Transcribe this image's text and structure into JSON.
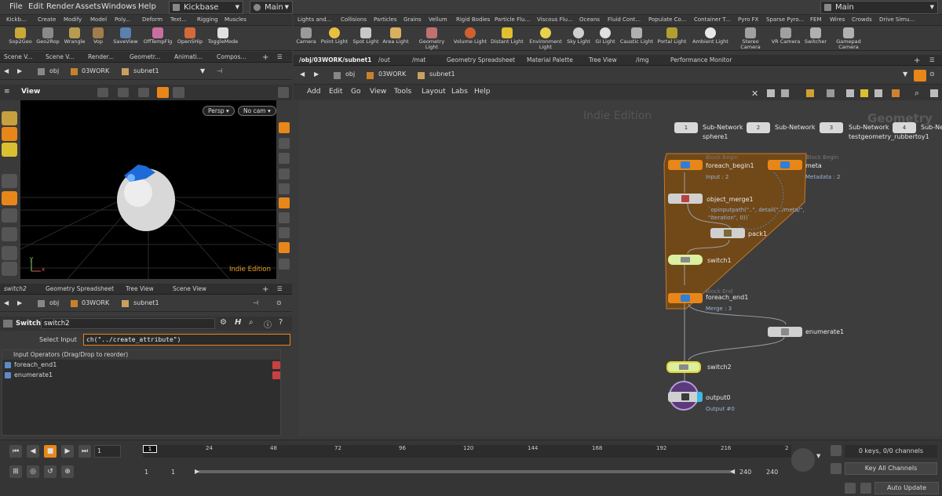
{
  "menu": {
    "file": "File",
    "edit": "Edit",
    "render": "Render",
    "assets": "Assets",
    "windows": "Windows",
    "help": "Help"
  },
  "desktop": {
    "value": "Kickbase"
  },
  "takes": {
    "value": "Main"
  },
  "right_main": {
    "value": "Main"
  },
  "left_shelf_tabs": [
    "Kickb...",
    "Create",
    "Modify",
    "Model",
    "Poly...",
    "Deform",
    "Text...",
    "Rigging",
    "Muscles"
  ],
  "left_shelf_tools": [
    "Sop2Geo",
    "Geo2Rop",
    "Wrangle",
    "Vop",
    "SaveView",
    "OffTempFlg",
    "OpenSHip",
    "ToggleMode"
  ],
  "right_shelf_tabs": [
    "Lights and...",
    "Collisions",
    "Particles",
    "Grains",
    "Vellum",
    "Rigid Bodies",
    "Particle Flu...",
    "Viscous Flu...",
    "Oceans",
    "Fluid Cont...",
    "Populate Co...",
    "Container T...",
    "Pyro FX",
    "Sparse Pyro...",
    "FEM",
    "Wires",
    "Crowds",
    "Drive Simu..."
  ],
  "right_shelf_tools": [
    "Camera",
    "Point Light",
    "Spot Light",
    "Area Light",
    "Geometry Light",
    "Volume Light",
    "Distant Light",
    "Environment Light",
    "Sky Light",
    "GI Light",
    "Caustic Light",
    "Portal Light",
    "Ambient Light",
    "Stereo Camera",
    "VR Camera",
    "Switcher",
    "Gamepad Camera"
  ],
  "scene_tabs": [
    "Scene V...",
    "Scene V...",
    "Render...",
    "Geometr...",
    "Animati...",
    "Compos..."
  ],
  "net_tabs": [
    "/obj/03WORK/subnet1",
    "/out",
    "/mat",
    "Geometry Spreadsheet",
    "Material Palette",
    "Tree View",
    "/img",
    "Performance Monitor"
  ],
  "path": {
    "obj": "obj",
    "work": "03WORK",
    "subnet": "subnet1"
  },
  "viewport": {
    "title": "View",
    "persp": "Persp",
    "cam": "No cam",
    "edition": "Indie Edition",
    "axis_x": "x",
    "axis_y": "y"
  },
  "bottom_tabs": [
    "switch2",
    "Geometry Spreadsheet",
    "Tree View",
    "Scene View"
  ],
  "param": {
    "type": "Switch",
    "name": "switch2",
    "select_label": "Select Input",
    "select_value": "ch(\"../create_attribute\")",
    "inputs_header": "Input Operators (Drag/Drop to reorder)",
    "inputs": [
      "foreach_end1",
      "enumerate1"
    ]
  },
  "net_menu": [
    "Add",
    "Edit",
    "Go",
    "View",
    "Tools",
    "Layout",
    "Labs",
    "Help"
  ],
  "network": {
    "watermark": "Indie Edition",
    "context": "Geometry",
    "subnets": [
      {
        "num": "1",
        "type": "Sub-Network",
        "name": "sphere1"
      },
      {
        "num": "2",
        "type": "Sub-Network",
        "name": ""
      },
      {
        "num": "3",
        "type": "Sub-Network",
        "name": "testgeometry_rubbertoy1"
      },
      {
        "num": "4",
        "type": "Sub-Netw",
        "name": ""
      }
    ],
    "foreach_begin": {
      "ghost": "Block Begin",
      "name": "foreach_begin1",
      "sub": "Input : 2"
    },
    "meta": {
      "ghost": "Block Begin",
      "name": "meta",
      "sub": "Metadata : 2"
    },
    "object_merge": {
      "name": "object_merge1",
      "expr1": "`opinputpath(\"..\", detail(\"../meta/\",",
      "expr2": "\"iteration\", 0))`"
    },
    "pack": {
      "name": "pack1"
    },
    "switch1": {
      "name": "switch1"
    },
    "foreach_end": {
      "ghost": "Block End",
      "name": "foreach_end1",
      "sub": "Merge : 3"
    },
    "enumerate": {
      "name": "enumerate1"
    },
    "switch2": {
      "name": "switch2"
    },
    "output": {
      "name": "output0",
      "sub": "Output #0"
    }
  },
  "timeline": {
    "ticks": [
      "24",
      "48",
      "72",
      "96",
      "120",
      "144",
      "168",
      "192",
      "216",
      "2"
    ],
    "current": "1",
    "frame_field": "1",
    "start1": "1",
    "start2": "1",
    "end1": "240",
    "end2": "240",
    "keys": "0 keys, 0/0 channels",
    "key_all": "Key All Channels",
    "auto_update": "Auto Update"
  },
  "colors": {
    "accent": "#e8861a",
    "select": "#d8f0a0",
    "blockfill": "#7a4a12",
    "blue": "#2f7fd6"
  }
}
